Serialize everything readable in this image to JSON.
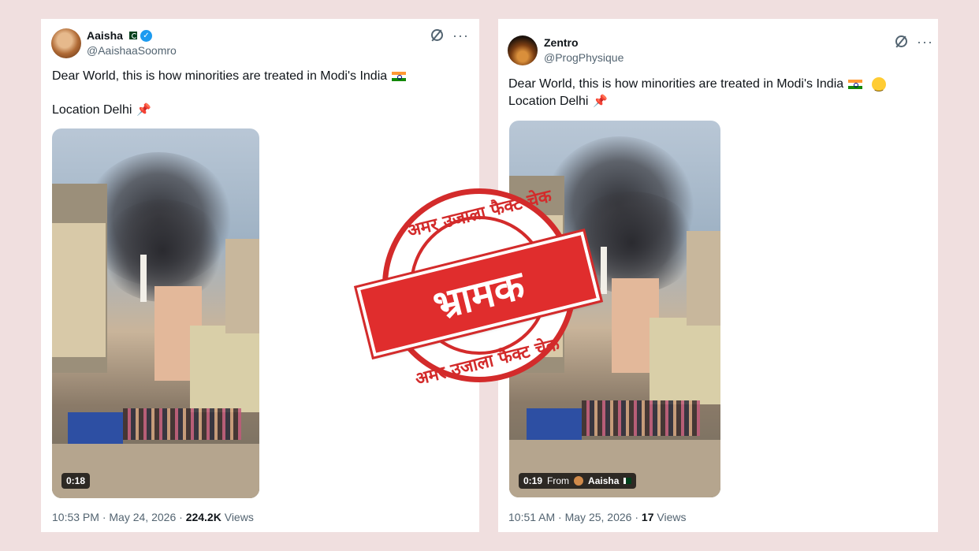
{
  "tweets": [
    {
      "author_name": "Aaisha",
      "handle": "@AaishaaSoomro",
      "text_line1": "Dear World, this is how minorities are treated in Modi's India",
      "text_line2": "Location Delhi",
      "video_duration": "0:18",
      "time": "10:53 PM",
      "date": "May 24, 2026",
      "views_count": "224.2K",
      "views_label": "Views"
    },
    {
      "author_name": "Zentro",
      "handle": "@ProgPhysique",
      "text_line1": "Dear World, this is how minorities are treated in Modi's India",
      "text_line2": "Location Delhi",
      "video_duration": "0:19",
      "video_from_label": "From",
      "video_from_name": "Aaisha",
      "time": "10:51 AM",
      "date": "May 25, 2026",
      "views_count": "17",
      "views_label": "Views"
    }
  ],
  "stamp": {
    "top_text": "अमर उजाला फैक्ट चेक",
    "verdict": "भ्रामक",
    "bottom_text": "अमर उजाला फैक्ट चेक"
  },
  "colors": {
    "background": "#f0dfdf",
    "stamp_red": "#d32b2b",
    "verified_blue": "#1d9bf0"
  },
  "icons": [
    "verified-icon",
    "pakistan-flag-icon",
    "india-flag-icon",
    "pushpin-icon",
    "grok-icon",
    "more-icon",
    "smile-icon"
  ]
}
